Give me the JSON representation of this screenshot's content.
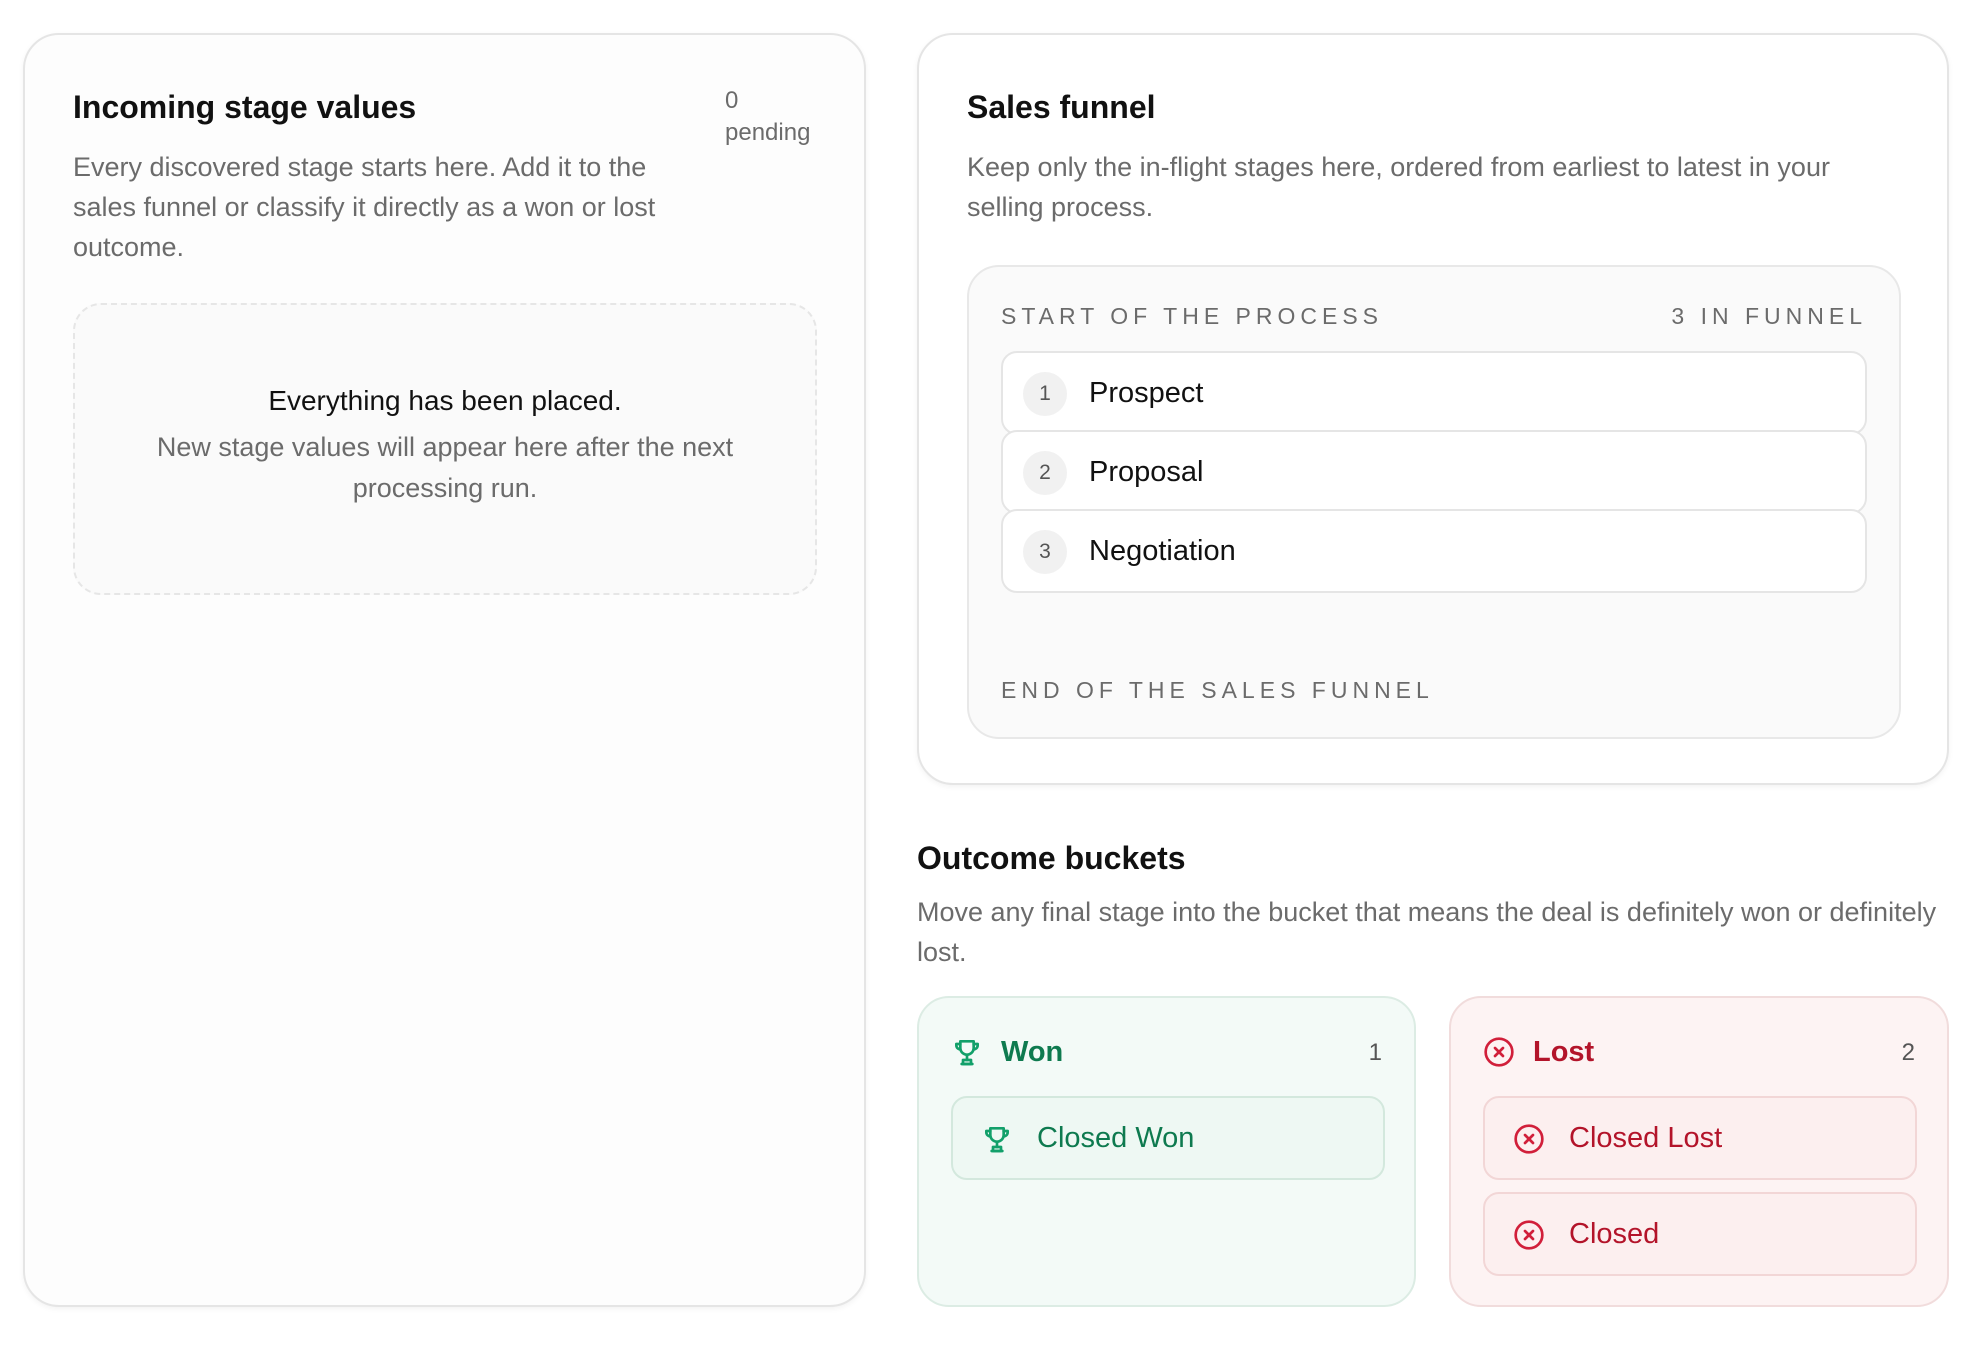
{
  "incoming": {
    "title": "Incoming stage values",
    "pending_count": "0",
    "pending_label": "pending",
    "description": "Every discovered stage starts here. Add it to the sales funnel or classify it directly as a won or lost outcome.",
    "empty_title": "Everything has been placed.",
    "empty_subtitle": "New stage values will appear here after the next processing run."
  },
  "funnel": {
    "title": "Sales funnel",
    "description": "Keep only the in-flight stages here, ordered from earliest to latest in your selling process.",
    "start_label": "START OF THE PROCESS",
    "count_label": "3 IN FUNNEL",
    "end_label": "END OF THE SALES FUNNEL",
    "stages": [
      {
        "num": "1",
        "label": "Prospect"
      },
      {
        "num": "2",
        "label": "Proposal"
      },
      {
        "num": "3",
        "label": "Negotiation"
      }
    ]
  },
  "outcomes": {
    "title": "Outcome buckets",
    "description": "Move any final stage into the bucket that means the deal is definitely won or definitely lost.",
    "won": {
      "label": "Won",
      "count": "1",
      "icon": "trophy-icon",
      "color": "#0e7a4f",
      "items": [
        {
          "label": "Closed Won"
        }
      ]
    },
    "lost": {
      "label": "Lost",
      "count": "2",
      "icon": "x-circle-icon",
      "color": "#b3142a",
      "items": [
        {
          "label": "Closed Lost"
        },
        {
          "label": "Closed"
        }
      ]
    }
  }
}
